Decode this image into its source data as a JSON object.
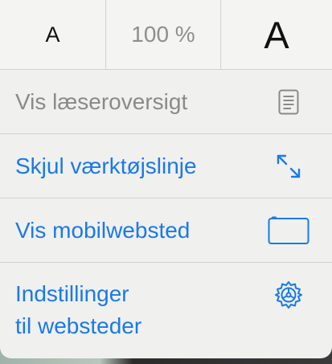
{
  "zoom": {
    "decrease_label": "A",
    "level": "100 %",
    "increase_label": "A"
  },
  "menu": {
    "reader": {
      "label": "Vis læseroversigt",
      "icon": "reader-view-icon"
    },
    "hide_toolbar": {
      "label": "Skjul værktøjslinje",
      "icon": "expand-arrows-icon"
    },
    "mobile_site": {
      "label": "Vis mobilwebsted",
      "icon": "mobile-device-icon"
    },
    "site_settings": {
      "label_line1": "Indstillinger",
      "label_line2": "til websteder",
      "icon": "gear-icon"
    }
  },
  "colors": {
    "accent": "#1a7ae8",
    "disabled": "#8a8a8a",
    "background": "#f0f0ef"
  }
}
